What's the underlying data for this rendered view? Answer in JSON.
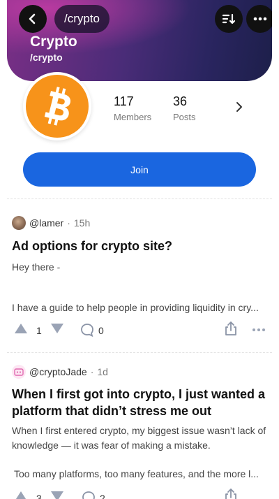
{
  "header": {
    "breadcrumb": "/crypto",
    "community_name": "Crypto",
    "community_handle": "/crypto"
  },
  "stats": {
    "members_count": "117",
    "members_label": "Members",
    "posts_count": "36",
    "posts_label": "Posts"
  },
  "join_label": "Join",
  "colors": {
    "join_button": "#1a66e0",
    "bitcoin_orange": "#f7931a",
    "icon_gray": "#9aa3b5"
  },
  "posts": [
    {
      "author": "@lamer",
      "time": "15h",
      "title": "Ad options for crypto site?",
      "body_line_1": "Hey there -",
      "body_line_2": "I have a guide to help people in providing liquidity in cry...",
      "votes": "1",
      "comments": "0"
    },
    {
      "author": "@cryptoJade",
      "time": "1d",
      "title": "When I first got into crypto, I just wanted a platform that didn’t stress me out",
      "body_line_1": "When I first entered crypto, my biggest issue wasn’t lack of knowledge — it was fear of making a mistake.",
      "body_line_2": "Too many platforms, too many features, and the more l...",
      "votes": "3",
      "comments": "2"
    }
  ]
}
